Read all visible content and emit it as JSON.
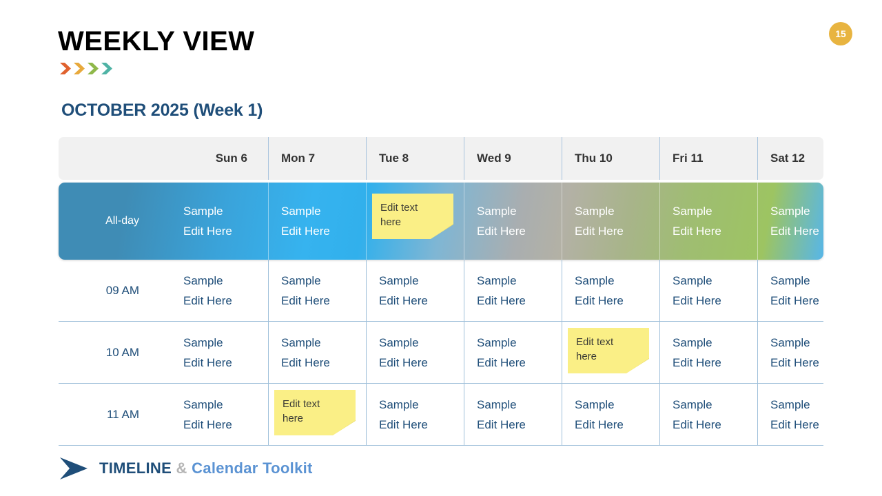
{
  "header": {
    "title": "WEEKLY VIEW",
    "page_number": "15",
    "badge_color": "#e8b440",
    "chevron_colors": [
      "#e0622f",
      "#e8a93c",
      "#8fb84a",
      "#4fb3a5"
    ]
  },
  "subtitle": "OCTOBER 2025 (Week 1)",
  "calendar": {
    "time_column_header": "",
    "day_headers": [
      "Sun 6",
      "Mon 7",
      "Tue 8",
      "Wed 9",
      "Thu 10",
      "Fri 11",
      "Sat 12"
    ],
    "allday_label": "All-day",
    "rows": [
      {
        "time": "All-day",
        "cells": [
          {
            "type": "event",
            "line1": "Sample",
            "line2": "Edit Here"
          },
          {
            "type": "event",
            "line1": "Sample",
            "line2": "Edit Here"
          },
          {
            "type": "sticky",
            "line1": "Edit text",
            "line2": "here"
          },
          {
            "type": "event",
            "line1": "Sample",
            "line2": "Edit Here"
          },
          {
            "type": "event",
            "line1": "Sample",
            "line2": "Edit Here"
          },
          {
            "type": "event",
            "line1": "Sample",
            "line2": "Edit Here"
          },
          {
            "type": "event",
            "line1": "Sample",
            "line2": "Edit Here"
          }
        ]
      },
      {
        "time": "09 AM",
        "cells": [
          {
            "type": "event",
            "line1": "Sample",
            "line2": "Edit Here"
          },
          {
            "type": "event",
            "line1": "Sample",
            "line2": "Edit Here"
          },
          {
            "type": "event",
            "line1": "Sample",
            "line2": "Edit Here"
          },
          {
            "type": "event",
            "line1": "Sample",
            "line2": "Edit Here"
          },
          {
            "type": "event",
            "line1": "Sample",
            "line2": "Edit Here"
          },
          {
            "type": "event",
            "line1": "Sample",
            "line2": "Edit Here"
          },
          {
            "type": "event",
            "line1": "Sample",
            "line2": "Edit Here"
          }
        ]
      },
      {
        "time": "10 AM",
        "cells": [
          {
            "type": "event",
            "line1": "Sample",
            "line2": "Edit Here"
          },
          {
            "type": "event",
            "line1": "Sample",
            "line2": "Edit Here"
          },
          {
            "type": "event",
            "line1": "Sample",
            "line2": "Edit Here"
          },
          {
            "type": "event",
            "line1": "Sample",
            "line2": "Edit Here"
          },
          {
            "type": "sticky",
            "line1": "Edit text",
            "line2": "here"
          },
          {
            "type": "event",
            "line1": "Sample",
            "line2": "Edit Here"
          },
          {
            "type": "event",
            "line1": "Sample",
            "line2": "Edit Here"
          }
        ]
      },
      {
        "time": "11 AM",
        "cells": [
          {
            "type": "event",
            "line1": "Sample",
            "line2": "Edit Here"
          },
          {
            "type": "sticky",
            "line1": "Edit text",
            "line2": "here"
          },
          {
            "type": "event",
            "line1": "Sample",
            "line2": "Edit Here"
          },
          {
            "type": "event",
            "line1": "Sample",
            "line2": "Edit Here"
          },
          {
            "type": "event",
            "line1": "Sample",
            "line2": "Edit Here"
          },
          {
            "type": "event",
            "line1": "Sample",
            "line2": "Edit Here"
          },
          {
            "type": "event",
            "line1": "Sample",
            "line2": "Edit Here"
          }
        ]
      }
    ]
  },
  "footer": {
    "brand": "TIMELINE",
    "amp": "&",
    "suffix": "Calendar Toolkit",
    "brand_color": "#1f4e79",
    "suffix_color": "#5b93d3"
  }
}
